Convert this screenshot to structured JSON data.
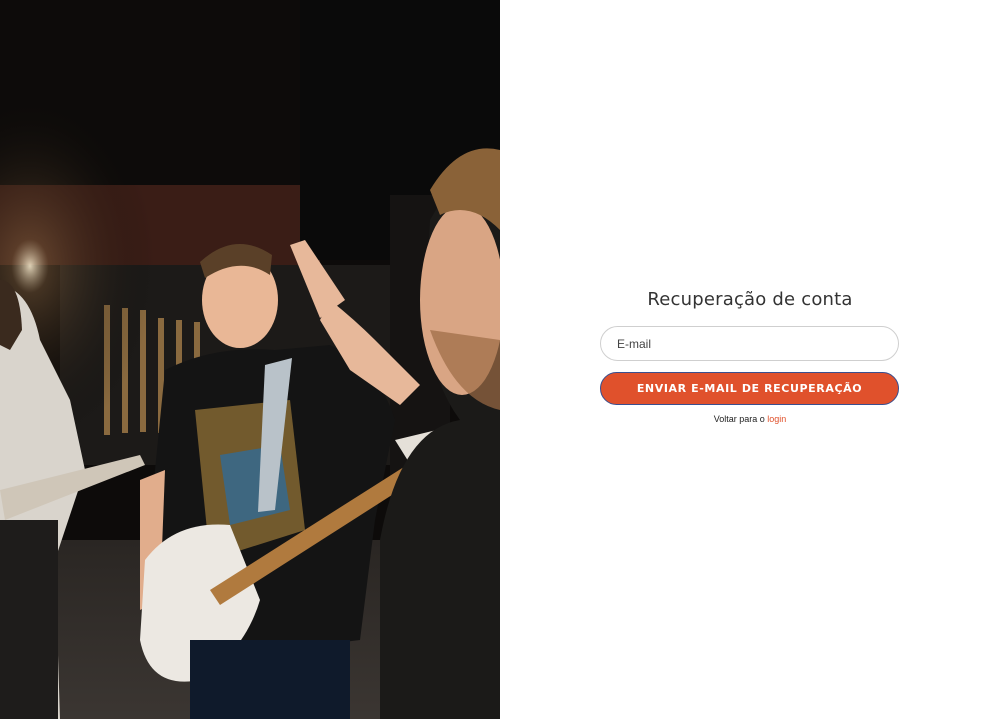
{
  "background_photo": {
    "alt_description": ""
  },
  "form": {
    "title": "Recuperação de conta",
    "email": {
      "placeholder": "E-mail",
      "value": ""
    },
    "submit_label": "ENVIAR E-MAIL DE RECUPERAÇÃO",
    "back_text": "Voltar para o",
    "back_link_label": "login"
  },
  "colors": {
    "accent": "#e0512c",
    "button_border": "#3a4f8f",
    "input_border": "#cfcfcf",
    "title_text": "#333333"
  }
}
